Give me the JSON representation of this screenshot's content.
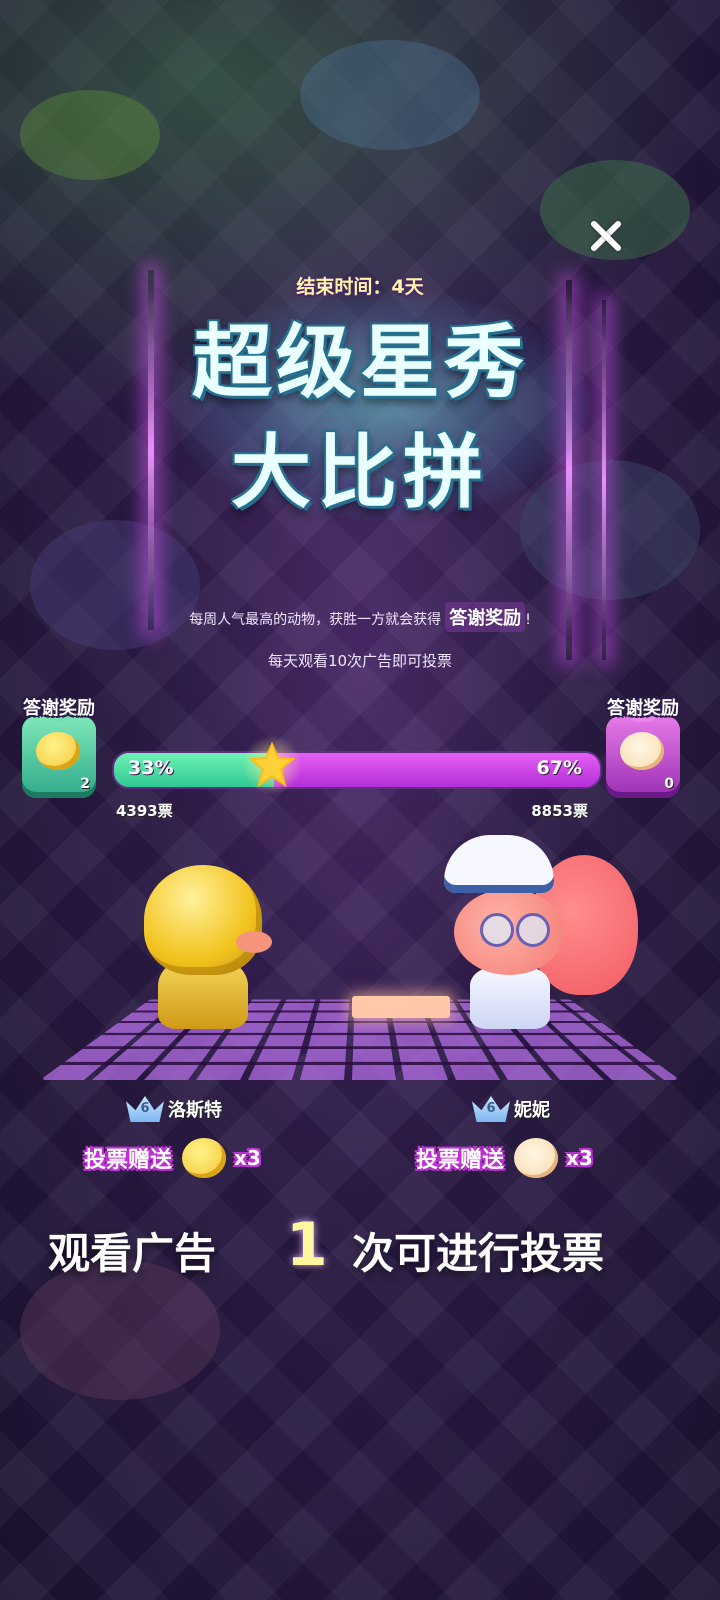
{
  "event": {
    "end_time": "结束时间：4天",
    "title_line1": "超级星秀",
    "title_line2": "大比拼",
    "description": "每周人气最高的动物，获胜一方就会获得",
    "description_highlight": "答谢奖励",
    "description_suffix": "!",
    "rule": "每天观看10次广告即可投票"
  },
  "rewards": {
    "left": {
      "label": "答谢奖励",
      "count": "2",
      "icon": "chick-icon"
    },
    "right": {
      "label": "答谢奖励",
      "count": "0",
      "icon": "hamster-icon"
    }
  },
  "vote_bar": {
    "left_percent_text": "33%",
    "right_percent_text": "67%",
    "left_fraction": 0.33,
    "right_fraction": 0.67,
    "left_votes": "4393票",
    "right_votes": "8853票",
    "left_color": "#3fd8a2",
    "right_color": "#c73ae6"
  },
  "contestants": {
    "left": {
      "level": "6",
      "name": "洛斯特",
      "gift_label": "投票赠送",
      "gift_mult": "x3"
    },
    "right": {
      "level": "6",
      "name": "妮妮",
      "gift_label": "投票赠送",
      "gift_mult": "x3"
    }
  },
  "cta": {
    "prefix": "观看广告",
    "count": "1",
    "suffix": "次可进行投票"
  }
}
